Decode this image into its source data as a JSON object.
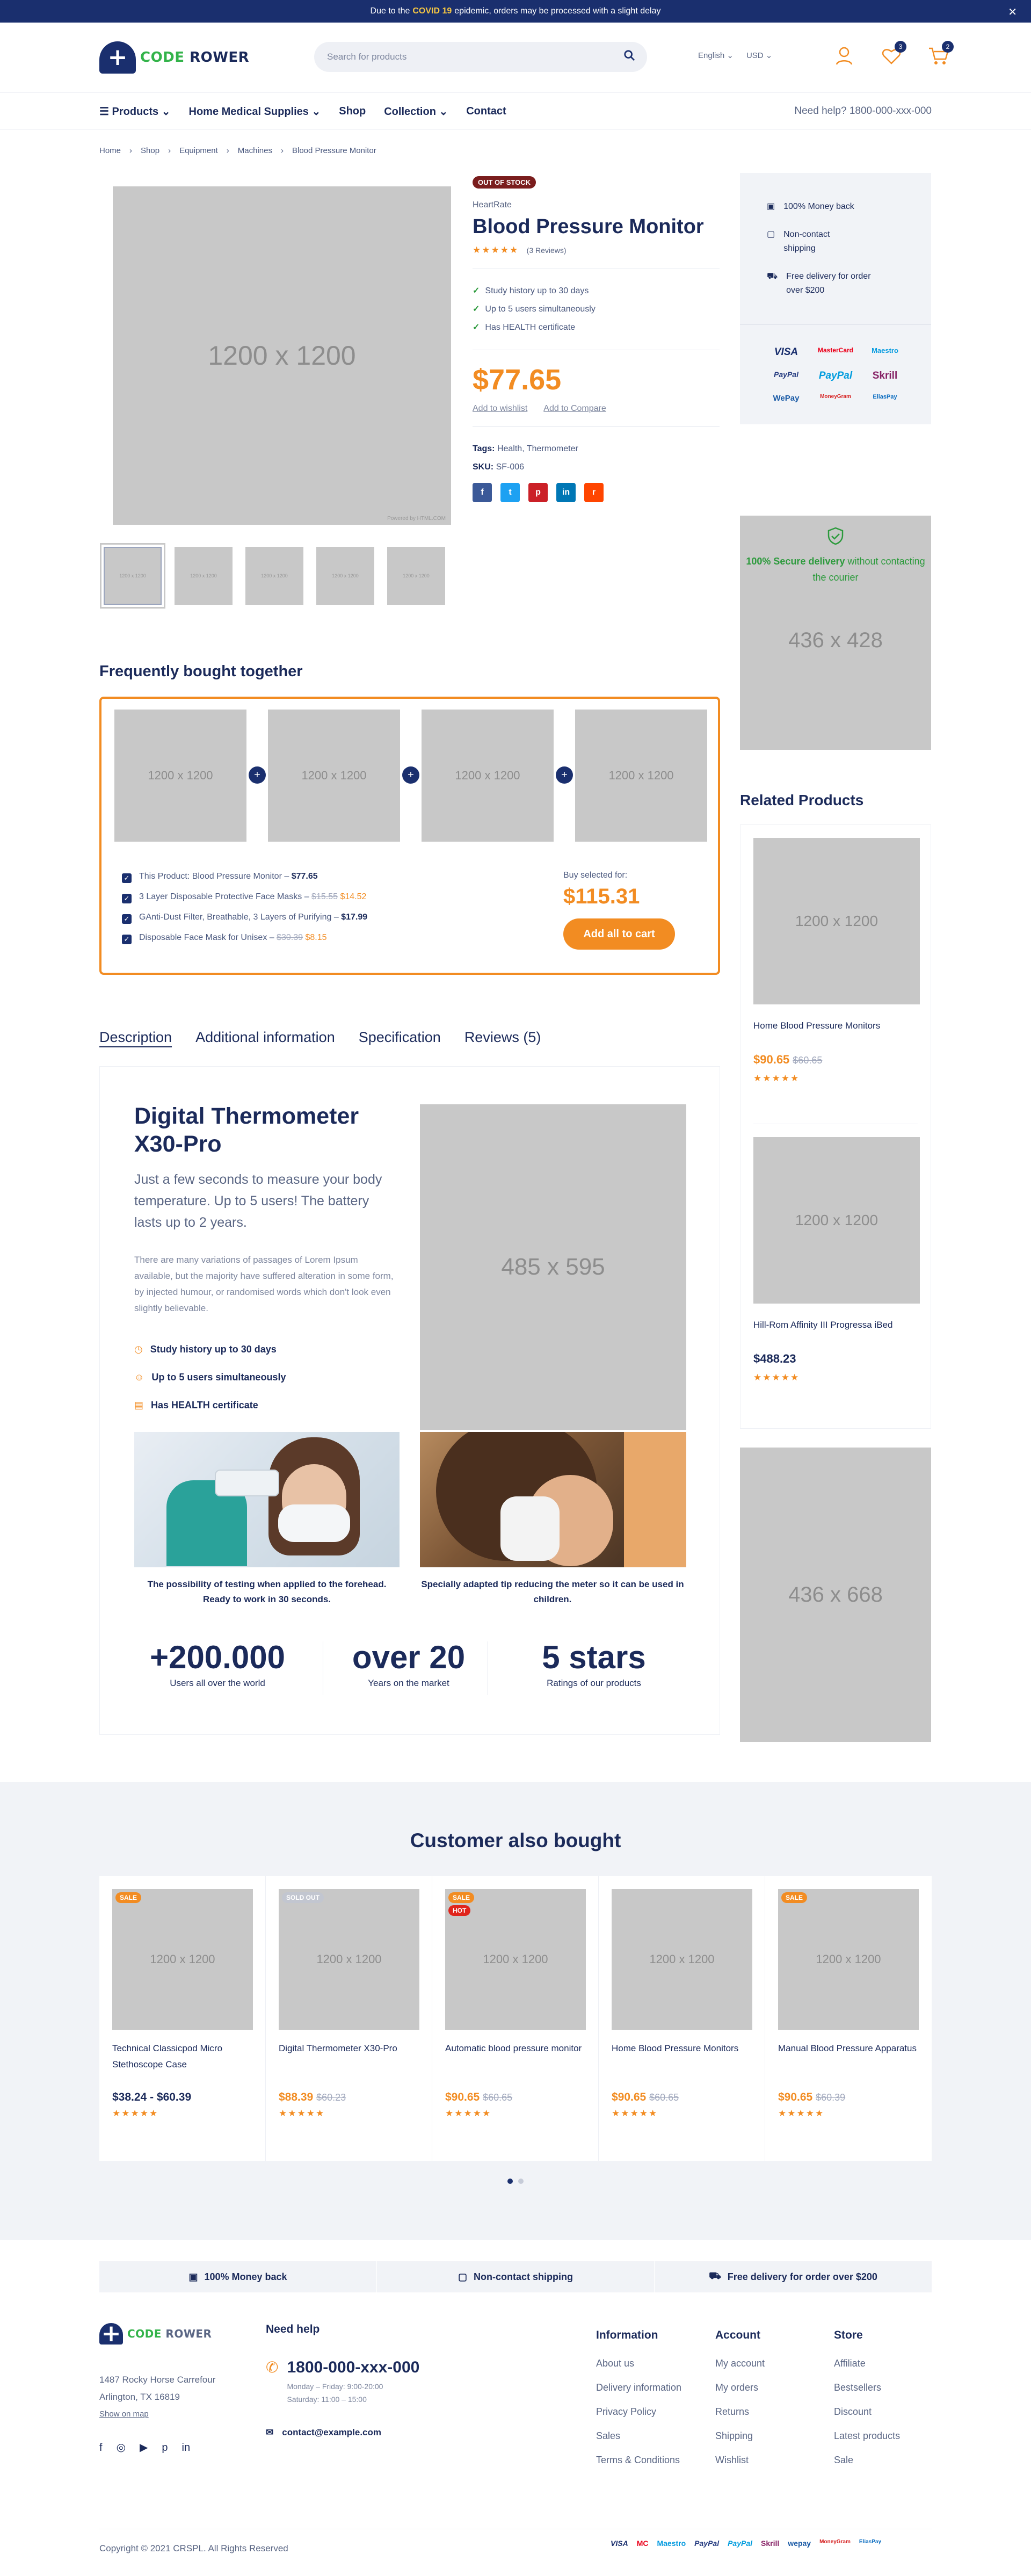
{
  "announcement": {
    "pre": "Due to the",
    "highlight": "COVID 19",
    "post": "epidemic, orders may be processed with a slight delay"
  },
  "brand": {
    "part1": "CODE",
    "part2": "ROWER"
  },
  "search": {
    "placeholder": "Search for products"
  },
  "header": {
    "language": "English",
    "currency": "USD",
    "wishlist_count": "3",
    "cart_count": "2"
  },
  "nav": {
    "items": [
      "Products",
      "Home Medical Supplies",
      "Shop",
      "Collection",
      "Contact"
    ],
    "help": "Need help? 1800-000-xxx-000"
  },
  "breadcrumbs": [
    "Home",
    "Shop",
    "Equipment",
    "Machines",
    "Blood Pressure Monitor"
  ],
  "product": {
    "status": "OUT OF STOCK",
    "brand": "HeartRate",
    "title": "Blood Pressure Monitor",
    "reviews": "(3 Reviews)",
    "features": [
      "Study history up to 30 days",
      "Up to 5 users simultaneously",
      "Has HEALTH certificate"
    ],
    "price": "$77.65",
    "wishlist_link": "Add to wishlist",
    "compare_link": "Add to Compare",
    "tags_label": "Tags:",
    "tags": "Health,   Thermometer",
    "sku_label": "SKU:",
    "sku": "SF-006",
    "main_image": "1200 x 1200",
    "thumb_label": "1200 x 1200",
    "powered": "Powered by HTML.COM"
  },
  "sidebar": {
    "perks": [
      "100% Money back",
      "Non-contact shipping",
      "Free delivery for order over $200"
    ],
    "payments": [
      "VISA",
      "MasterCard",
      "Maestro",
      "PayPal",
      "PayPal",
      "Skrill",
      "WePay",
      "MoneyGram",
      "EliasPay"
    ],
    "secure_title": "100% Secure delivery",
    "secure_rest": "without contacting the courier",
    "secure_placeholder": "436 x 428",
    "banner2": "436 x 668"
  },
  "related": {
    "title": "Related Products",
    "items": [
      {
        "name": "Home Blood Pressure Monitors",
        "price": "$90.65",
        "old": "$60.65",
        "img": "1200 x 1200"
      },
      {
        "name": "Hill-Rom Affinity III Progressa iBed",
        "price": "$488.23",
        "old": "",
        "img": "1200 x 1200"
      }
    ]
  },
  "fbt": {
    "title": "Frequently bought together",
    "img": "1200 x 1200",
    "items": [
      {
        "label": "This Product: Blood Pressure Monitor –",
        "old": "",
        "price": "$77.65"
      },
      {
        "label": "3 Layer Disposable Protective Face Masks –",
        "old": "$15.55",
        "price": "$14.52"
      },
      {
        "label": "GAnti-Dust Filter, Breathable, 3 Layers of Purifying –",
        "old": "",
        "price": "$17.99"
      },
      {
        "label": "Disposable Face Mask for Unisex –",
        "old": "$30.39",
        "price": "$8.15"
      }
    ],
    "buy_label": "Buy selected for:",
    "total": "$115.31",
    "button": "Add all to cart"
  },
  "tabs": [
    "Description",
    "Additional information",
    "Specification",
    "Reviews (5)"
  ],
  "description": {
    "title": "Digital Thermometer X30-Pro",
    "lead": "Just a few seconds to measure your body temperature. Up to 5 users! The battery lasts up to 2 years.",
    "body": "There are many variations of passages of Lorem Ipsum available, but the majority have suffered alteration in some form, by injected humour, or randomised words which don't look even slightly believable.",
    "features": [
      "Study history up to 30 days",
      "Up to 5 users simultaneously",
      "Has HEALTH certificate"
    ],
    "image": "485 x 595",
    "caption1": "The possibility of testing when applied to the forehead. Ready to work in 30 seconds.",
    "caption2": "Specially adapted tip reducing the meter so it can be used in children.",
    "stats": [
      {
        "big": "+200.000",
        "small": "Users all over the world"
      },
      {
        "big": "over 20",
        "small": "Years on the market"
      },
      {
        "big": "5 stars",
        "small": "Ratings of our products"
      }
    ]
  },
  "also_bought": {
    "title": "Customer also bought",
    "img": "1200 x 1200",
    "items": [
      {
        "badge": "SALE",
        "badge2": "",
        "name": "Technical Classicpod Micro Stethoscope Case",
        "price": "$38.24 - $60.39",
        "old": ""
      },
      {
        "badge": "SOLD OUT",
        "badge2": "",
        "name": "Digital Thermometer X30-Pro",
        "price": "$88.39",
        "old": "$60.23"
      },
      {
        "badge": "SALE",
        "badge2": "HOT",
        "name": "Automatic blood pressure monitor",
        "price": "$90.65",
        "old": "$60.65"
      },
      {
        "badge": "",
        "badge2": "",
        "name": "Home Blood Pressure Monitors",
        "price": "$90.65",
        "old": "$60.65"
      },
      {
        "badge": "SALE",
        "badge2": "",
        "name": "Manual Blood Pressure Apparatus",
        "price": "$90.65",
        "old": "$60.39"
      }
    ]
  },
  "footer": {
    "perks": [
      "100% Money back",
      "Non-contact shipping",
      "Free delivery for order over $200"
    ],
    "address1": "1487 Rocky Horse Carrefour",
    "address2": "Arlington, TX 16819",
    "map_link": "Show on map",
    "help_title": "Need help",
    "phone": "1800-000-xxx-000",
    "hours1": "Monday – Friday: 9:00-20:00",
    "hours2": "Saturday: 11:00 – 15:00",
    "email": "contact@example.com",
    "columns": [
      {
        "title": "Information",
        "links": [
          "About us",
          "Delivery information",
          "Privacy Policy",
          "Sales",
          "Terms & Conditions"
        ]
      },
      {
        "title": "Account",
        "links": [
          "My account",
          "My orders",
          "Returns",
          "Shipping",
          "Wishlist"
        ]
      },
      {
        "title": "Store",
        "links": [
          "Affiliate",
          "Bestsellers",
          "Discount",
          "Latest products",
          "Sale"
        ]
      }
    ],
    "copyright": "Copyright © 2021 CRSPL. All Rights Reserved",
    "payments": [
      "VISA",
      "MC",
      "Maestro",
      "PayPal",
      "PayPal",
      "Skrill",
      "wepay",
      "MoneyGram",
      "EliasPay"
    ]
  },
  "colors": {
    "navy": "#1a2f6e",
    "orange": "#f28c22",
    "green": "#33b34a",
    "oos": "#7a1d1d"
  }
}
